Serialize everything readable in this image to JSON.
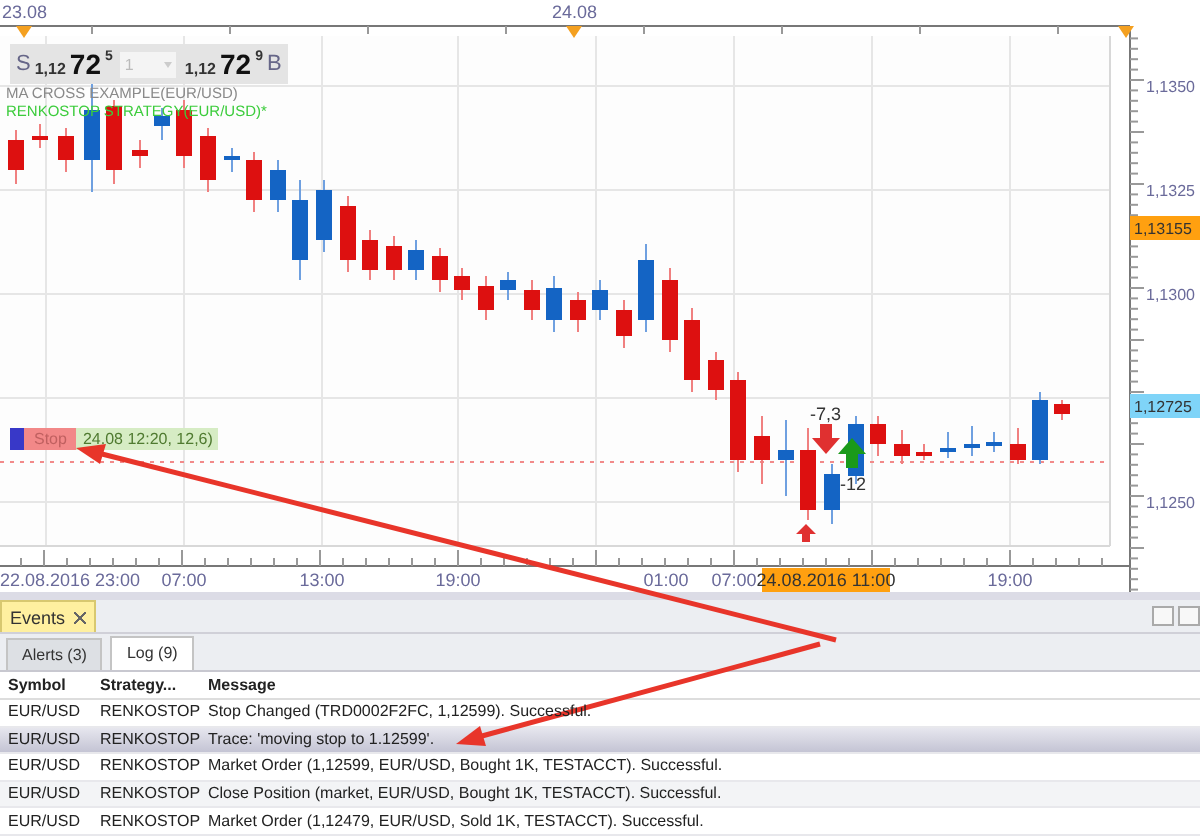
{
  "top_axis": [
    "23.08",
    "24.08"
  ],
  "quote": {
    "sell_label": "S",
    "sell_prefix": "1,12",
    "sell_pips": "72",
    "sell_fraction": "5",
    "quantity": "1",
    "buy_prefix": "1,12",
    "buy_pips": "72",
    "buy_fraction": "9",
    "buy_label": "B"
  },
  "strategies": [
    {
      "name": "MA CROSS EXAMPLE(EUR/USD)",
      "color": "#8a8a8a"
    },
    {
      "name": "RENKOSTOP STRATEGY(EUR/USD)*",
      "color": "#3ccc3c"
    }
  ],
  "price_axis": [
    "1,1350",
    "1,1325",
    "1,1300",
    "1,1250"
  ],
  "price_markers": [
    {
      "label": "1,13155",
      "color": "#ffa010"
    },
    {
      "label": "1,12725",
      "color": "#7fd4f8"
    }
  ],
  "time_axis": [
    {
      "label": "22.08.2016 23:00",
      "highlighted": false
    },
    {
      "label": "07:00",
      "highlighted": false
    },
    {
      "label": "13:00",
      "highlighted": false
    },
    {
      "label": "19:00",
      "highlighted": false
    },
    {
      "label": "01:00",
      "highlighted": false
    },
    {
      "label": "07:00",
      "highlighted": false
    },
    {
      "label": "24.08.2016 11:00",
      "highlighted": true
    },
    {
      "label": "19:00",
      "highlighted": false
    }
  ],
  "stop_order": {
    "label": "Stop",
    "detail": "24.08 12:20, 12,6)"
  },
  "trade_marks": [
    {
      "kind": "sell",
      "label": "-7,3"
    },
    {
      "kind": "buy",
      "label": "-12"
    },
    {
      "kind": "entry"
    }
  ],
  "events_panel": {
    "title": "Events",
    "tabs": [
      {
        "label": "Alerts (3)",
        "selected": false
      },
      {
        "label": "Log (9)",
        "selected": true
      }
    ],
    "columns": [
      "Symbol",
      "Strategy...",
      "Message"
    ],
    "rows": [
      {
        "cells": [
          "EUR/USD",
          "RENKOSTOP",
          "Stop Changed (TRD0002F2FC, 1,12599). Successful."
        ],
        "selected": false
      },
      {
        "cells": [
          "EUR/USD",
          "RENKOSTOP",
          "Trace: 'moving stop to 1.12599'."
        ],
        "selected": true
      },
      {
        "cells": [
          "EUR/USD",
          "RENKOSTOP",
          "Market Order (1,12599, EUR/USD, Bought 1K, TESTACCT). Successful."
        ],
        "selected": false
      },
      {
        "cells": [
          "EUR/USD",
          "RENKOSTOP",
          "Close Position (market, EUR/USD, Bought 1K, TESTACCT). Successful."
        ],
        "selected": false
      },
      {
        "cells": [
          "EUR/USD",
          "RENKOSTOP",
          "Market Order (1,12479, EUR/USD, Sold 1K, TESTACCT). Successful."
        ],
        "selected": false
      }
    ]
  }
}
